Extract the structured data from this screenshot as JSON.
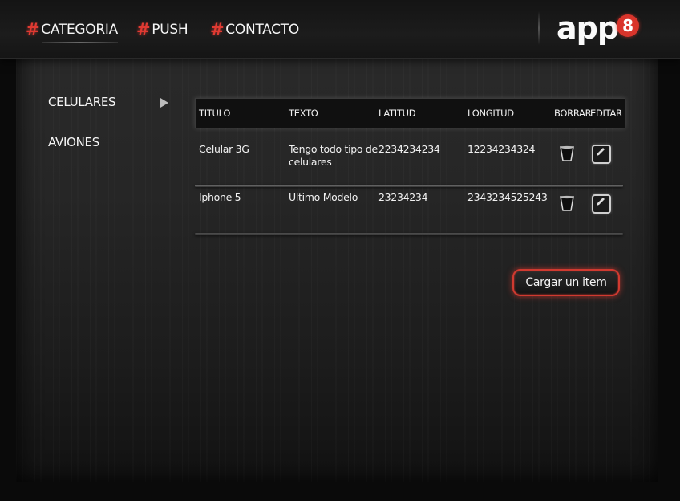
{
  "nav": {
    "items": [
      {
        "label": "CATEGORIA",
        "active": true
      },
      {
        "label": "PUSH",
        "active": false
      },
      {
        "label": "CONTACTO",
        "active": false
      }
    ],
    "hash_symbol": "#"
  },
  "logo": {
    "text": "app",
    "badge": "8",
    "badge_color": "#d9342b"
  },
  "sidebar": {
    "items": [
      {
        "label": "CELULARES",
        "selected": true
      },
      {
        "label": "AVIONES",
        "selected": false
      }
    ],
    "selected_indicator_icon": "triangle-right-icon"
  },
  "table": {
    "headers": [
      "TITULO",
      "TEXTO",
      "LATITUD",
      "LONGITUD",
      "BORRAR",
      "EDITAR"
    ],
    "rows": [
      {
        "titulo": "Celular 3G",
        "texto": "Tengo todo tipo de celulares",
        "latitud": "2234234234",
        "longitud": "12234234324"
      },
      {
        "titulo": "Iphone 5",
        "texto": "Ultimo Modelo",
        "latitud": "23234234",
        "longitud": "2343234525243"
      }
    ],
    "delete_icon": "trash-icon",
    "edit_icon": "edit-icon"
  },
  "actions": {
    "add_item_label": "Cargar un item"
  },
  "colors": {
    "accent": "#e03a32",
    "background": "#222222",
    "text": "#f2f2f2"
  }
}
